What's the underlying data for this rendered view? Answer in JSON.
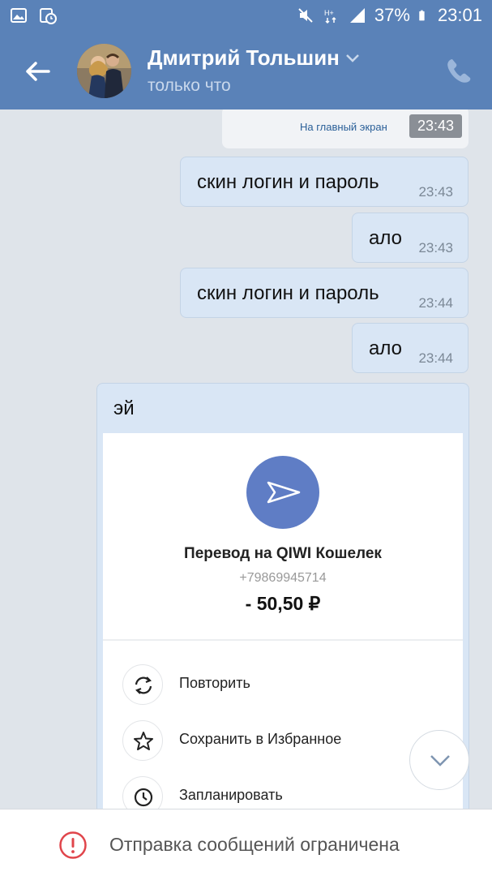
{
  "status_bar": {
    "battery": "37%",
    "time": "23:01",
    "icons": [
      "gallery-icon",
      "clock-image-icon",
      "mute-icon",
      "network-icon",
      "signal-icon",
      "battery-icon"
    ]
  },
  "header": {
    "name": "Дмитрий Тольшин",
    "status": "только что",
    "icons": [
      "back-arrow-icon",
      "chevron-down-icon",
      "phone-icon"
    ]
  },
  "top_message": {
    "link": "На главный экран",
    "time": "23:43"
  },
  "messages": [
    {
      "text": "скин логин и пароль",
      "time": "23:43"
    },
    {
      "text": "ало",
      "time": "23:43"
    },
    {
      "text": "скин логин и пароль",
      "time": "23:44"
    },
    {
      "text": "ало",
      "time": "23:44"
    }
  ],
  "card": {
    "text": "эй",
    "receipt": {
      "title": "Перевод на QIWI Кошелек",
      "phone": "+79869945714",
      "amount": "- 50,50 ₽",
      "accent": "#5f7dc5"
    },
    "actions": [
      {
        "label": "Повторить",
        "icon": "repeat-icon"
      },
      {
        "label": "Сохранить в Избранное",
        "icon": "star-icon"
      },
      {
        "label": "Запланировать",
        "icon": "clock-icon"
      }
    ]
  },
  "bottom_bar": {
    "message": "Отправка сообщений ограничена",
    "warn_color": "#e0454b"
  },
  "colors": {
    "header": "#5a82b8",
    "bubble": "#d9e6f5",
    "background": "#dfe4ea"
  }
}
